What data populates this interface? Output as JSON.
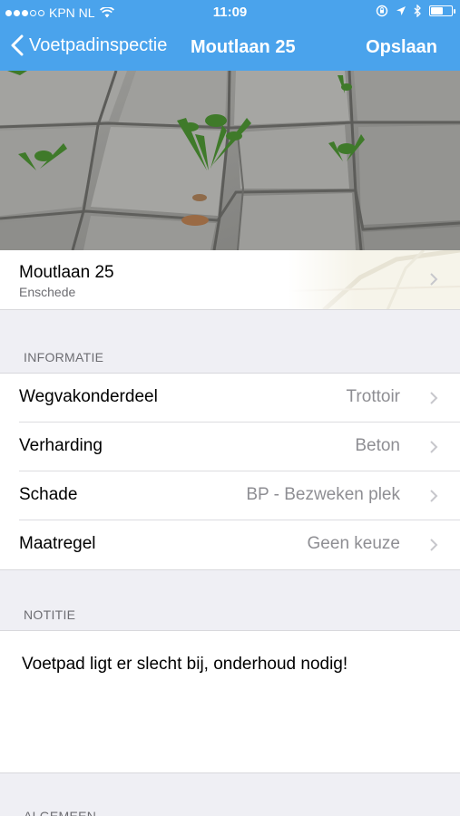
{
  "status_bar": {
    "carrier": "KPN NL",
    "time": "11:09",
    "signal_bars_filled": 3,
    "signal_bars_total": 5,
    "battery_level": 0.6
  },
  "nav": {
    "back_label": "Voetpadinspectie",
    "title": "Moutlaan 25",
    "save_label": "Opslaan"
  },
  "location": {
    "title": "Moutlaan 25",
    "subtitle": "Enschede"
  },
  "informatie": {
    "header": "INFORMATIE",
    "rows": [
      {
        "label": "Wegvakonderdeel",
        "value": "Trottoir"
      },
      {
        "label": "Verharding",
        "value": "Beton"
      },
      {
        "label": "Schade",
        "value": "BP - Bezweken plek"
      },
      {
        "label": "Maatregel",
        "value": "Geen keuze"
      }
    ]
  },
  "notitie": {
    "header": "NOTITIE",
    "text": "Voetpad ligt er slecht bij, onderhoud nodig!"
  },
  "algemeen": {
    "header": "ALGEMEEN"
  },
  "colors": {
    "accent": "#4aa3ec",
    "background": "#efeff4",
    "secondary_text": "#8e8e93"
  },
  "icons": [
    "wifi-icon",
    "lock-rotation-icon",
    "location-arrow-icon",
    "bluetooth-icon",
    "battery-icon",
    "back-chevron-icon",
    "chevron-right-icon"
  ]
}
